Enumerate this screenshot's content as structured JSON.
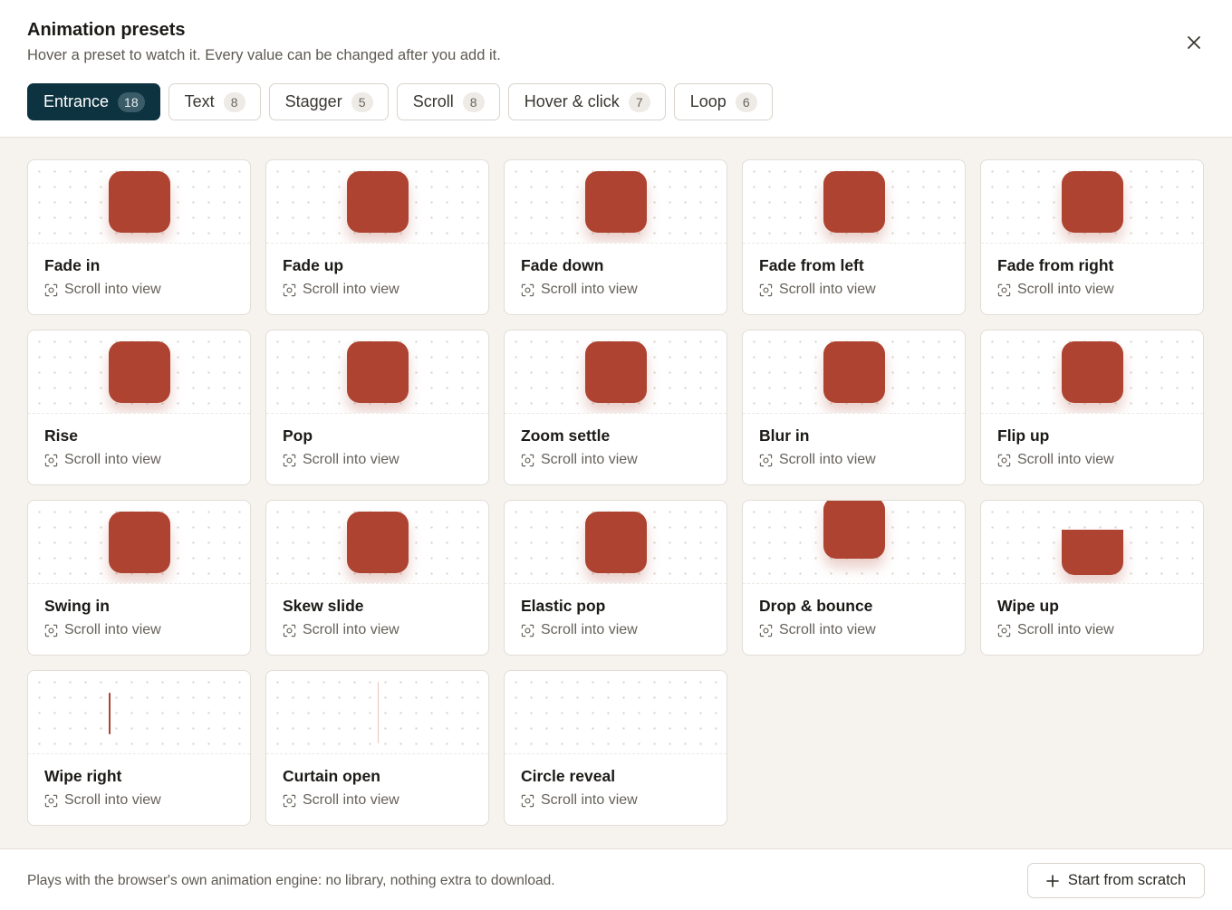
{
  "dialog": {
    "title": "Animation presets",
    "subtitle": "Hover a preset to watch it. Every value can be changed after you add it.",
    "close_icon": "close-icon"
  },
  "tabs": [
    {
      "label": "Entrance",
      "count": "18",
      "active": true
    },
    {
      "label": "Text",
      "count": "8"
    },
    {
      "label": "Stagger",
      "count": "5"
    },
    {
      "label": "Scroll",
      "count": "8"
    },
    {
      "label": "Hover & click",
      "count": "7"
    },
    {
      "label": "Loop",
      "count": "6"
    }
  ],
  "presets": [
    {
      "name": "Fade in",
      "trigger": "Scroll into view",
      "preview": "square"
    },
    {
      "name": "Fade up",
      "trigger": "Scroll into view",
      "preview": "square"
    },
    {
      "name": "Fade down",
      "trigger": "Scroll into view",
      "preview": "square"
    },
    {
      "name": "Fade from left",
      "trigger": "Scroll into view",
      "preview": "square"
    },
    {
      "name": "Fade from right",
      "trigger": "Scroll into view",
      "preview": "square"
    },
    {
      "name": "Rise",
      "trigger": "Scroll into view",
      "preview": "square"
    },
    {
      "name": "Pop",
      "trigger": "Scroll into view",
      "preview": "square"
    },
    {
      "name": "Zoom settle",
      "trigger": "Scroll into view",
      "preview": "square"
    },
    {
      "name": "Blur in",
      "trigger": "Scroll into view",
      "preview": "square"
    },
    {
      "name": "Flip up",
      "trigger": "Scroll into view",
      "preview": "square"
    },
    {
      "name": "Swing in",
      "trigger": "Scroll into view",
      "preview": "square"
    },
    {
      "name": "Skew slide",
      "trigger": "Scroll into view",
      "preview": "square"
    },
    {
      "name": "Elastic pop",
      "trigger": "Scroll into view",
      "preview": "square"
    },
    {
      "name": "Drop & bounce",
      "trigger": "Scroll into view",
      "preview": "drop"
    },
    {
      "name": "Wipe up",
      "trigger": "Scroll into view",
      "preview": "wipeup"
    },
    {
      "name": "Wipe right",
      "trigger": "Scroll into view",
      "preview": "sliver"
    },
    {
      "name": "Curtain open",
      "trigger": "Scroll into view",
      "preview": "sliver faint"
    },
    {
      "name": "Circle reveal",
      "trigger": "Scroll into view",
      "preview": "none"
    }
  ],
  "trigger_icon": "scroll-view-icon",
  "footer": {
    "note": "Plays with the browser's own animation engine: no library, nothing extra to download.",
    "button_label": "Start from scratch",
    "button_icon": "plus-icon"
  },
  "colors": {
    "accent": "#0d3340",
    "preview_shape": "#ad4330"
  }
}
